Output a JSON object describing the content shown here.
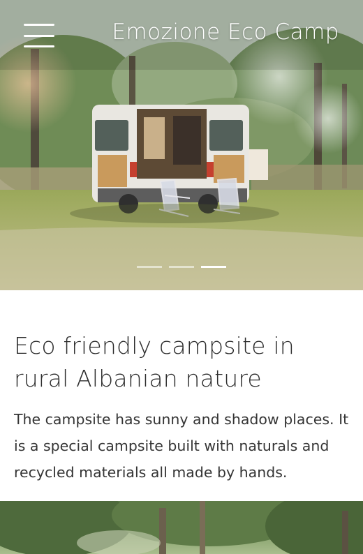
{
  "header": {
    "brand": "Emozione Eco Camp",
    "menu_icon": "hamburger-menu-icon"
  },
  "hero": {
    "slides_total": 3,
    "active_slide": 3
  },
  "content": {
    "headline": "Eco friendly campsite in rural Albanian nature",
    "description": "The campsite has sunny and shadow places. It is a special campsite built with naturals and recycled materials all made by hands."
  },
  "colors": {
    "background": "#ffffff",
    "text": "#2d2d2d",
    "overlay_text": "#ffffff"
  }
}
